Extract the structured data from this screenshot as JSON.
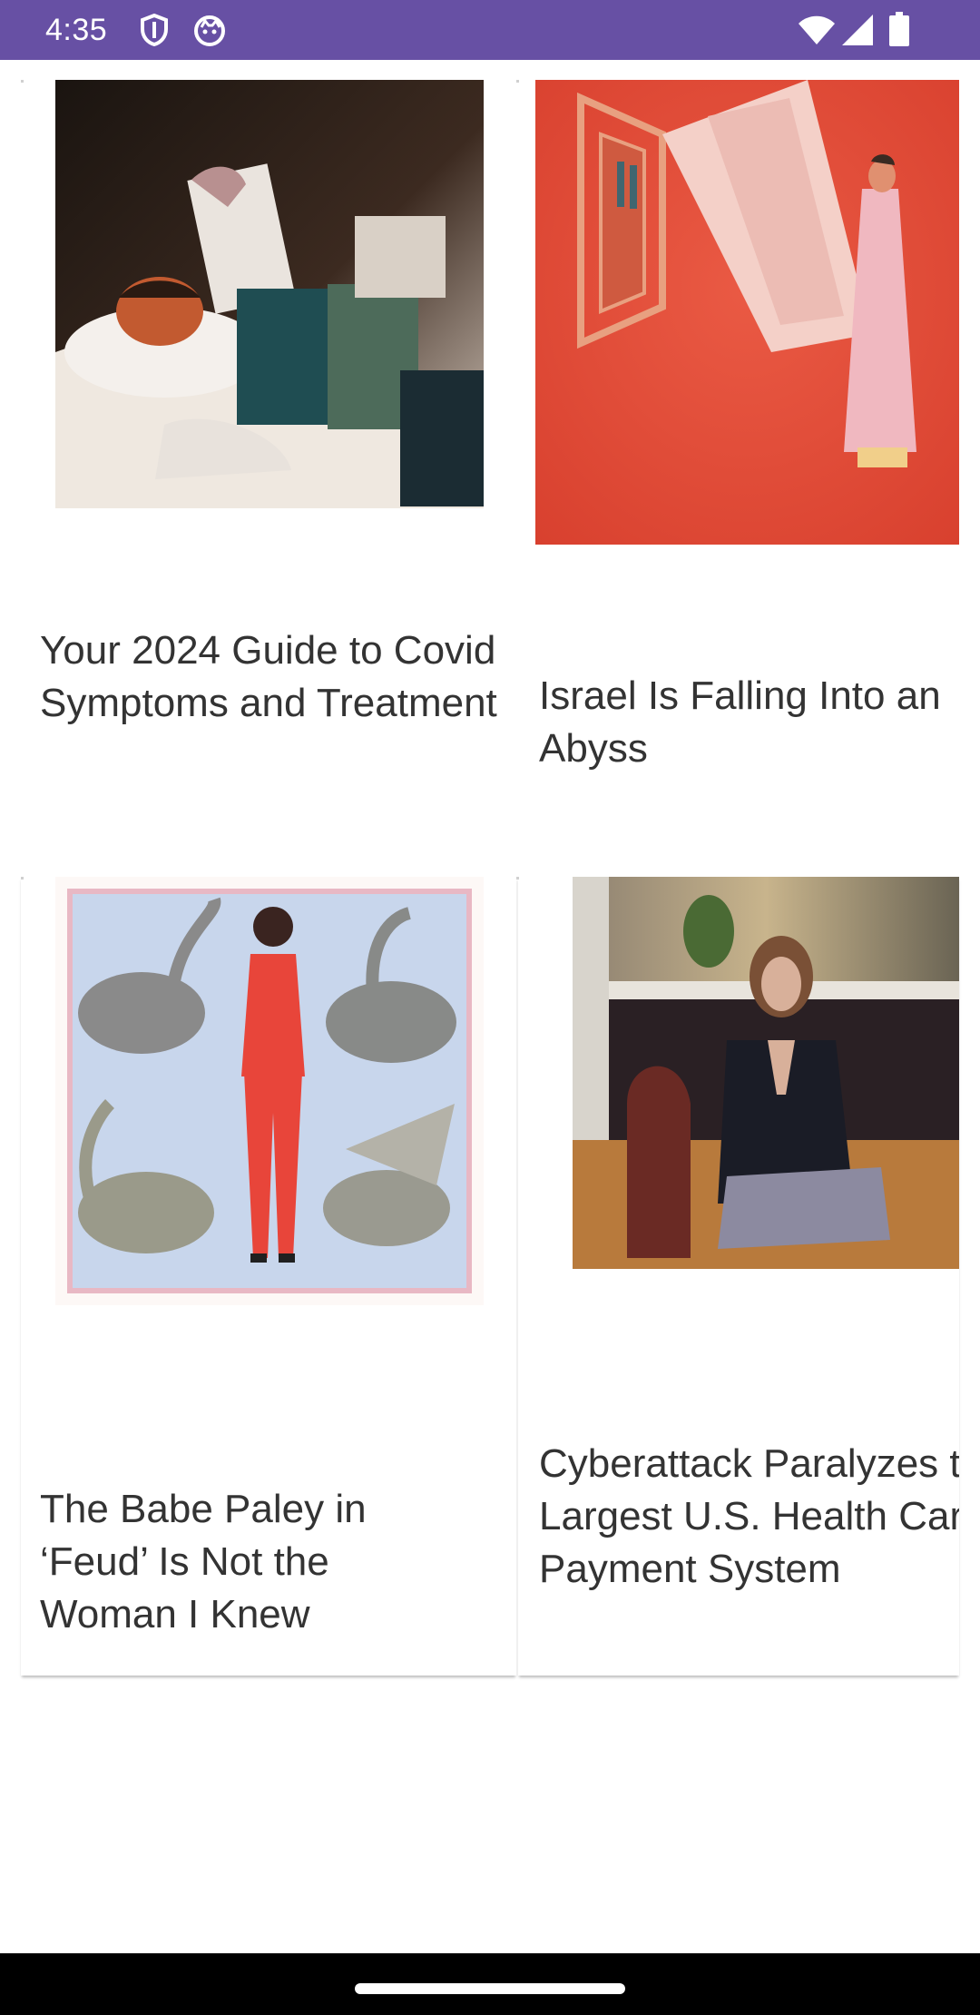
{
  "status_bar": {
    "time": "4:35",
    "background": "#6750a4",
    "left_icons": [
      "shield-icon",
      "face-icon"
    ],
    "right_icons": [
      "wifi-icon",
      "signal-icon",
      "battery-icon"
    ]
  },
  "articles": [
    {
      "title": "Your 2024 Guide to Covid Symptoms and Treatment",
      "image": "sick-person-tissue-illustration"
    },
    {
      "title": "Israel Is Falling Into an Abyss",
      "image": "red-window-figure-illustration"
    },
    {
      "title": "The Babe Paley in ‘Feud’ Is Not the Woman I Knew",
      "image": "woman-with-swans-illustration"
    },
    {
      "title": "Cyberattack Paralyzes the Largest U.S. Health Care Payment System",
      "image": "woman-seated-office-photo"
    }
  ],
  "nav_bar": {
    "handle": "home-gesture-handle"
  }
}
